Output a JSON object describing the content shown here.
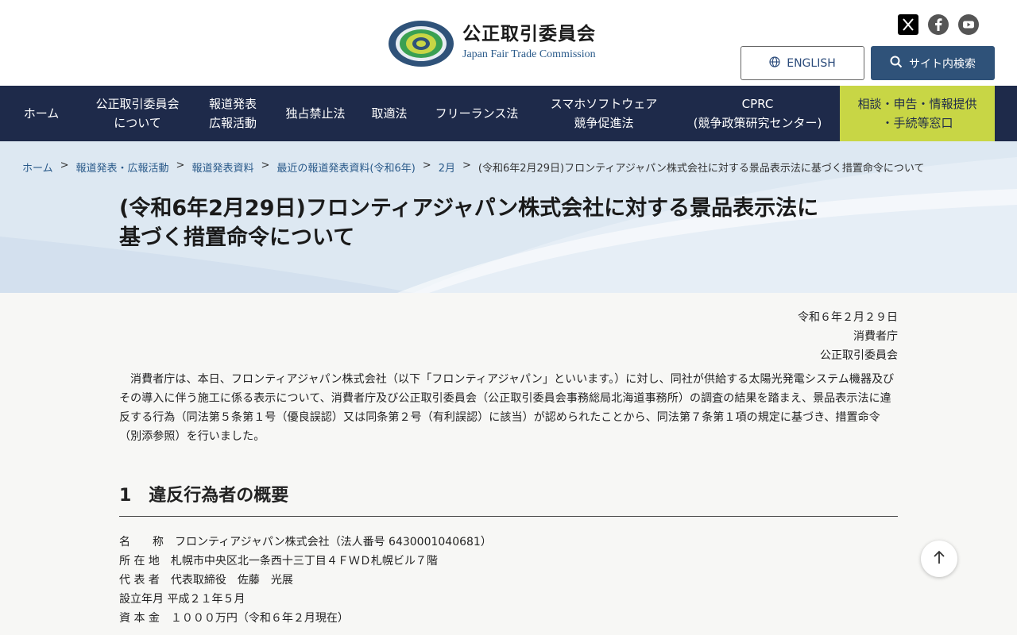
{
  "header": {
    "logo_jp": "公正取引委員会",
    "logo_en": "Japan Fair Trade Commission",
    "english_label": "ENGLISH",
    "search_label": "サイト内検索"
  },
  "nav": {
    "items": [
      {
        "line1": "ホーム",
        "line2": ""
      },
      {
        "line1": "公正取引委員会",
        "line2": "について"
      },
      {
        "line1": "報道発表",
        "line2": "広報活動"
      },
      {
        "line1": "独占禁止法",
        "line2": ""
      },
      {
        "line1": "取適法",
        "line2": ""
      },
      {
        "line1": "フリーランス法",
        "line2": ""
      },
      {
        "line1": "スマホソフトウェア",
        "line2": "競争促進法"
      },
      {
        "line1": "CPRC",
        "line2": "(競争政策研究センター)"
      },
      {
        "line1": "相談・申告・情報提供",
        "line2": "・手続等窓口"
      }
    ]
  },
  "breadcrumb": {
    "items": [
      "ホーム",
      "報道発表・広報活動",
      "報道発表資料",
      "最近の報道発表資料(令和6年)",
      "2月"
    ],
    "current": "(令和6年2月29日)フロンティアジャパン株式会社に対する景品表示法に基づく措置命令について",
    "separator": ">"
  },
  "page": {
    "title_line1": "(令和6年2月29日)フロンティアジャパン株式会社に対する景品表示法に",
    "title_line2": "基づく措置命令について"
  },
  "meta": {
    "date": "令和６年２月２９日",
    "org1": "消費者庁",
    "org2": "公正取引委員会"
  },
  "body": {
    "paragraph": "消費者庁は、本日、フロンティアジャパン株式会社（以下「フロンティアジャパン」といいます。）に対し、同社が供給する太陽光発電システム機器及びその導入に伴う施工に係る表示について、消費者庁及び公正取引委員会（公正取引委員会事務総局北海道事務所）の調査の結果を踏まえ、景品表示法に違反する行為（同法第５条第１号（優良誤認）又は同条第２号（有利誤認）に該当）が認められたことから、同法第７条第１項の規定に基づき、措置命令（別添参照）を行いました。"
  },
  "section": {
    "title": "1　違反行為者の概要",
    "details": [
      "名　　称　フロンティアジャパン株式会社（法人番号 6430001040681）",
      "所 在 地　札幌市中央区北一条西十三丁目４ＦＷＤ札幌ビル７階",
      "代 表 者　代表取締役　佐藤　光展",
      "設立年月 平成２１年５月",
      "資 本 金　１０００万円（令和６年２月現在）"
    ]
  },
  "colors": {
    "nav_bg": "#1e2a4a",
    "nav_highlight": "#c8d645",
    "accent": "#2f5279"
  }
}
